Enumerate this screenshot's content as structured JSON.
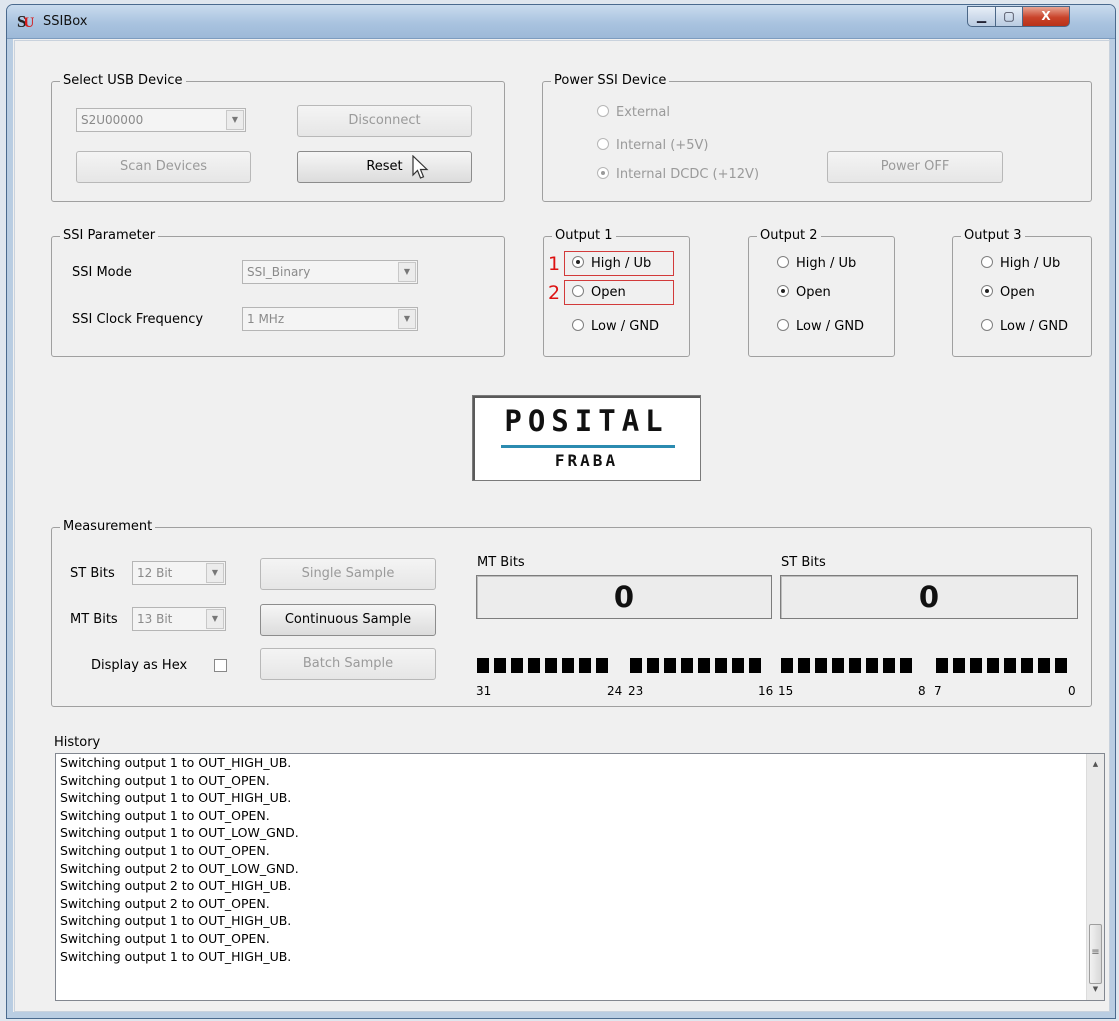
{
  "window": {
    "title": "SSIBox",
    "minimize": "▁",
    "maximize": "▢",
    "close": "X"
  },
  "usb": {
    "legend": "Select USB Device",
    "device": "S2U00000",
    "disconnect": "Disconnect",
    "scan": "Scan Devices",
    "reset": "Reset"
  },
  "power": {
    "legend": "Power SSI Device",
    "options": [
      "External",
      "Internal (+5V)",
      "Internal DCDC (+12V)"
    ],
    "selected": 2,
    "power_off": "Power OFF"
  },
  "ssi": {
    "legend": "SSI Parameter",
    "mode_label": "SSI Mode",
    "mode_value": "SSI_Binary",
    "clock_label": "SSI Clock Frequency",
    "clock_value": "1 MHz"
  },
  "outputs": [
    {
      "legend": "Output 1",
      "options": [
        "High / Ub",
        "Open",
        "Low / GND"
      ],
      "selected": 0
    },
    {
      "legend": "Output 2",
      "options": [
        "High / Ub",
        "Open",
        "Low / GND"
      ],
      "selected": 1
    },
    {
      "legend": "Output 3",
      "options": [
        "High / Ub",
        "Open",
        "Low / GND"
      ],
      "selected": 1
    }
  ],
  "annotations": {
    "one": "1",
    "two": "2"
  },
  "logo": {
    "main": "POSITAL",
    "sub": "FRABA"
  },
  "measurement": {
    "legend": "Measurement",
    "st_bits_label": "ST Bits",
    "st_bits_value": "12 Bit",
    "mt_bits_label": "MT Bits",
    "mt_bits_value": "13 Bit",
    "hex_label": "Display as Hex",
    "single": "Single Sample",
    "continuous": "Continuous Sample",
    "batch": "Batch Sample",
    "mt_display_label": "MT Bits",
    "mt_display_value": "0",
    "st_display_label": "ST Bits",
    "st_display_value": "0",
    "bit_labels": [
      "31",
      "24",
      "23",
      "16",
      "15",
      "8",
      "7",
      "0"
    ]
  },
  "history": {
    "label": "History",
    "lines": [
      "Switching output 1 to OUT_HIGH_UB.",
      "Switching output 1 to OUT_OPEN.",
      "Switching output 1 to OUT_HIGH_UB.",
      "Switching output 1 to OUT_OPEN.",
      "Switching output 1 to OUT_LOW_GND.",
      "Switching output 1 to OUT_OPEN.",
      "Switching output 2 to OUT_LOW_GND.",
      "Switching output 2 to OUT_HIGH_UB.",
      "Switching output 2 to OUT_OPEN.",
      "Switching output 1 to OUT_HIGH_UB.",
      "Switching output 1 to OUT_OPEN.",
      "Switching output 1 to OUT_HIGH_UB."
    ]
  }
}
